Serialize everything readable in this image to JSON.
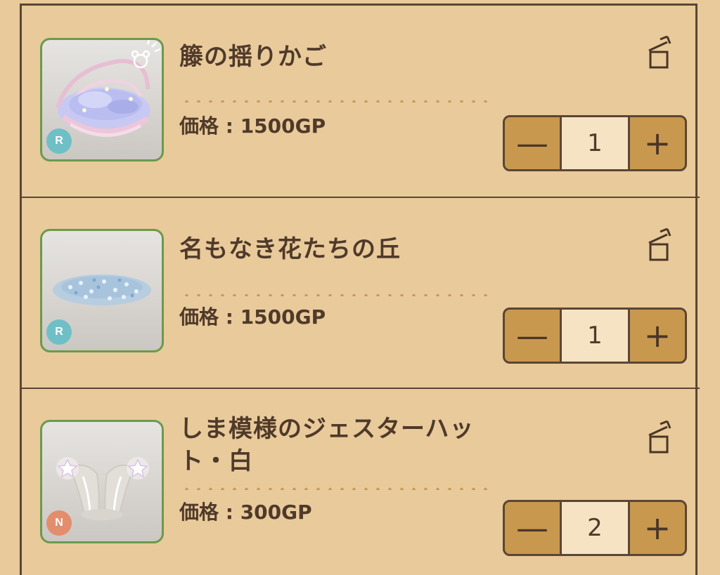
{
  "colors": {
    "background": "#e9ca9b",
    "border": "#5a4634",
    "text": "#4f3a2a",
    "thumb_border": "#6b9a4b",
    "stepper_fill": "#c9984f",
    "qty_fill": "#f5e3c4",
    "rarity_R": "#6fbfc6",
    "rarity_N": "#e38d6c"
  },
  "cart": {
    "items": [
      {
        "name": "籐の揺りかご",
        "price": "価格 : 1500GP",
        "quantity": "1",
        "rarity": "R",
        "thumbnail_icon": "wicker-cradle-image",
        "minus_label": "—",
        "plus_label": "+"
      },
      {
        "name": "名もなき花たちの丘",
        "price": "価格 : 1500GP",
        "quantity": "1",
        "rarity": "R",
        "thumbnail_icon": "flower-hill-image",
        "minus_label": "—",
        "plus_label": "+"
      },
      {
        "name": "しま模様のジェスターハット・白",
        "price": "価格 : 300GP",
        "quantity": "2",
        "rarity": "N",
        "thumbnail_icon": "jester-hat-image",
        "minus_label": "—",
        "plus_label": "+"
      }
    ]
  }
}
